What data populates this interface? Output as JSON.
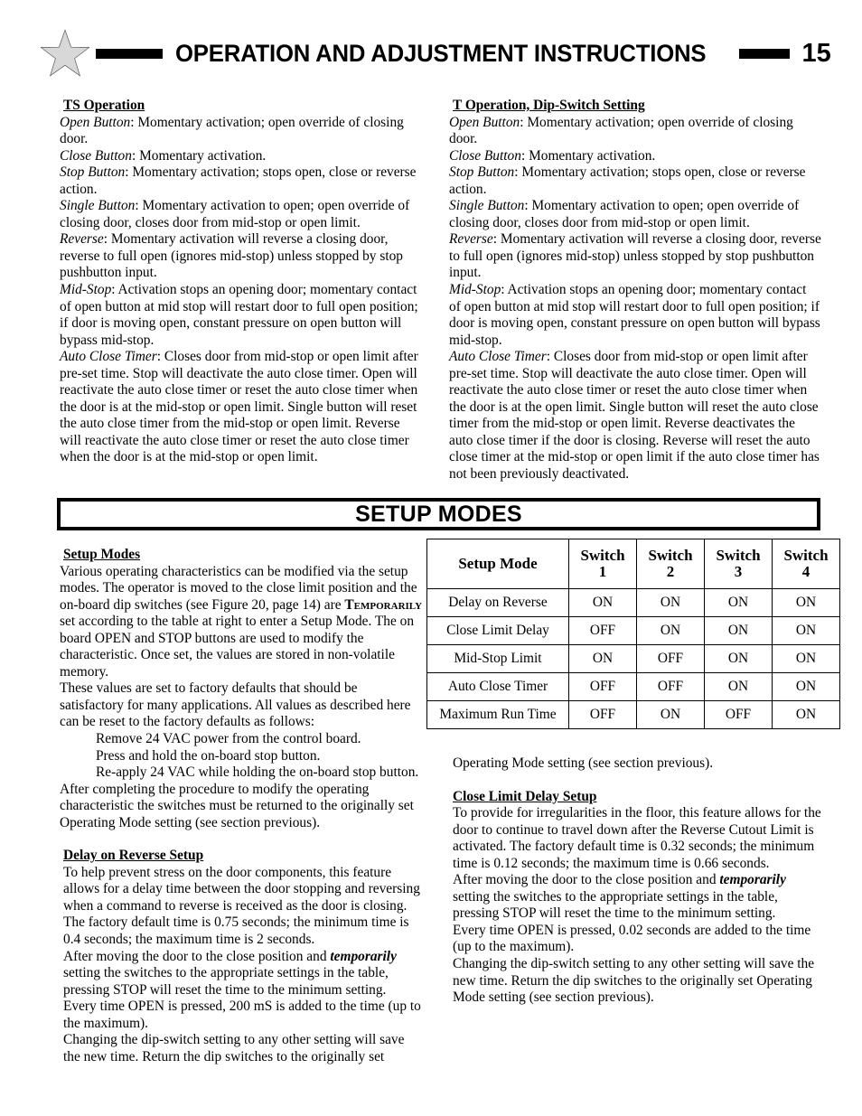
{
  "header": {
    "title": "OPERATION AND ADJUSTMENT INSTRUCTIONS",
    "page_number": "15",
    "star_icon": "star-icon",
    "rule_left": "horizontal-rule",
    "rule_right": "horizontal-rule"
  },
  "left_top": {
    "heading": "TS Operation",
    "entries": [
      {
        "term": "Open Button",
        "text": ": Momentary activation; open override of closing door."
      },
      {
        "term": "Close Button",
        "text": ": Momentary activation."
      },
      {
        "term": "Stop Button",
        "text": ": Momentary activation; stops open, close or reverse action."
      },
      {
        "term": "Single Button",
        "text": ": Momentary activation to open; open override of closing door, closes door from mid-stop or open limit."
      },
      {
        "term": "Reverse",
        "text": ": Momentary activation will reverse a closing door, reverse to full open (ignores mid-stop) unless stopped by stop pushbutton input."
      },
      {
        "term": "Mid-Stop",
        "text": ": Activation stops an opening door; momentary contact of open button at mid stop will restart door to full open position; if door is moving open, constant pressure on open button will bypass mid-stop."
      },
      {
        "term": "Auto Close Timer",
        "text": ": Closes door from mid-stop or open limit after pre-set time. Stop will deactivate the auto close timer. Open will reactivate the auto close timer or reset the auto close timer when the door is at the mid-stop or open limit. Single button will reset the auto close timer from the mid-stop or open limit. Reverse will reactivate the auto close timer or reset the auto close timer when the door is at the mid-stop or open limit."
      }
    ]
  },
  "right_top": {
    "heading": "T Operation, Dip-Switch Setting",
    "entries": [
      {
        "term": "Open Button",
        "text": ": Momentary activation; open override of closing door."
      },
      {
        "term": "Close Button",
        "text": ": Momentary activation."
      },
      {
        "term": "Stop Button",
        "text": ": Momentary activation; stops open, close or reverse action."
      },
      {
        "term": "Single Button",
        "text": ": Momentary activation to open; open override of closing door, closes door from mid-stop or open limit."
      },
      {
        "term": "Reverse",
        "text": ": Momentary activation will reverse a closing door, reverse to full open (ignores mid-stop) unless stopped by stop pushbutton input."
      },
      {
        "term": "Mid-Stop",
        "text": ": Activation stops an opening door; momentary contact of open button at mid stop will restart door to full open position; if door is moving open, constant pressure on open button will bypass mid-stop."
      },
      {
        "term": "Auto Close Timer",
        "text": ": Closes door from mid-stop or open limit after pre-set time. Stop will deactivate the auto close timer. Open will reactivate the auto close timer or reset the auto close timer when the door is at the open limit. Single button will reset the auto close timer from the mid-stop or open limit. Reverse deactivates the auto close timer if the door is closing. Reverse will reset the auto close timer at the mid-stop or open limit if the auto close timer has not been previously deactivated."
      }
    ]
  },
  "banner": {
    "title": "SETUP MODES"
  },
  "setup_modes": {
    "heading": "Setup Modes",
    "p1_a": "Various operating characteristics can be modified via the setup modes. The operator is moved to the close limit position and the on-board dip switches (see Figure 20, page 14) are ",
    "p1_smallcaps": "Temporarily",
    "p1_b": " set according to the table at right to enter a Setup Mode. The on board OPEN and STOP buttons are used to modify the characteristic. Once set, the values are stored in non-volatile memory.",
    "p2": "These values are set to factory defaults that should be satisfactory for many applications. All values as described here can be reset to the factory defaults as follows:",
    "steps": [
      "Remove 24 VAC power from the control board.",
      "Press and hold the on-board stop button.",
      "Re-apply 24 VAC while holding the on-board stop button."
    ],
    "p3": "After completing the procedure to modify the operating characteristic the switches must be returned to the originally set Operating Mode setting (see section previous)."
  },
  "delay_on_reverse": {
    "heading": "Delay on Reverse Setup",
    "p1": "To help prevent stress on the door components, this feature allows for a delay time between the door stopping and reversing when a command to reverse is received as the door is closing. The factory default time is 0.75 seconds; the minimum time is 0.4 seconds; the maximum time is 2 seconds.",
    "p2_a": "After moving the door to the close position and ",
    "p2_em": "temporarily",
    "p2_b": " setting the switches to the appropriate settings in the table, pressing STOP will reset the time to the minimum setting.",
    "p3": "Every time OPEN is pressed, 200 mS is added to the time (up to the maximum).",
    "p4": "Changing the dip-switch setting to any other setting will save the new time.  Return the dip switches to the originally set"
  },
  "close_limit_delay": {
    "continued_line": "Operating Mode setting (see section previous).",
    "heading": "Close Limit Delay Setup",
    "p1": "To provide for irregularities in the floor, this feature allows for the door to continue to travel down after the Reverse Cutout Limit is activated.  The factory default time is 0.32 seconds; the minimum time is 0.12 seconds; the maximum time is 0.66 seconds.",
    "p2_a": "After moving the door to the close position and ",
    "p2_em": "temporarily",
    "p2_b": " setting the switches to the appropriate settings in the table, pressing STOP will reset the time to the minimum setting.",
    "p3": "Every time OPEN is pressed, 0.02 seconds are added to the time (up to the maximum).",
    "p4": "Changing the dip-switch setting to any other setting will save the new time.  Return the dip switches to the originally set Operating Mode setting (see section previous)."
  },
  "chart_data": {
    "type": "table",
    "title": "Setup Mode dip-switch settings",
    "columns": [
      "Setup Mode",
      "Switch 1",
      "Switch 2",
      "Switch 3",
      "Switch 4"
    ],
    "column_header_lines": [
      [
        "Setup Mode"
      ],
      [
        "Switch",
        "1"
      ],
      [
        "Switch",
        "2"
      ],
      [
        "Switch",
        "3"
      ],
      [
        "Switch",
        "4"
      ]
    ],
    "rows": [
      {
        "mode": "Delay on Reverse",
        "switches": [
          "ON",
          "ON",
          "ON",
          "ON"
        ]
      },
      {
        "mode": "Close Limit Delay",
        "switches": [
          "OFF",
          "ON",
          "ON",
          "ON"
        ]
      },
      {
        "mode": "Mid-Stop Limit",
        "switches": [
          "ON",
          "OFF",
          "ON",
          "ON"
        ]
      },
      {
        "mode": "Auto Close Timer",
        "switches": [
          "OFF",
          "OFF",
          "ON",
          "ON"
        ]
      },
      {
        "mode": "Maximum Run Time",
        "switches": [
          "OFF",
          "ON",
          "OFF",
          "ON"
        ]
      }
    ]
  },
  "colors": {
    "ink": "#000000",
    "paper": "#ffffff",
    "star_fill": "#d8d8d8",
    "star_stroke": "#555555"
  }
}
